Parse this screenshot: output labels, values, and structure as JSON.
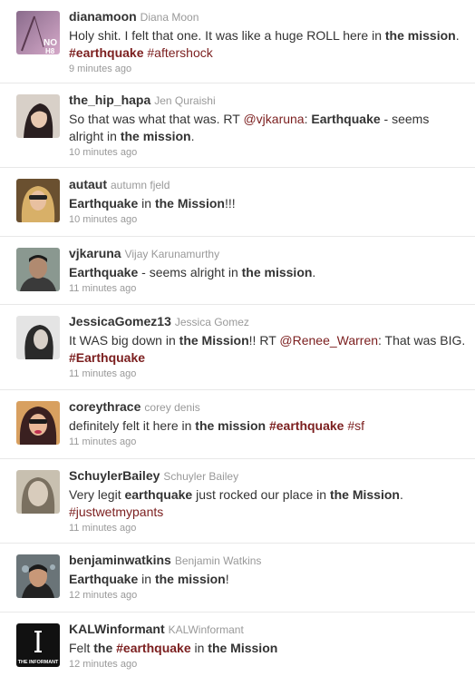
{
  "tweets": [
    {
      "username": "dianamoon",
      "fullname": "Diana Moon",
      "time": "9 minutes ago",
      "avatar_colors": [
        "#7a5c7a",
        "#c4a0c0"
      ],
      "parts": [
        {
          "t": "Holy shit. I felt that one. It was like a huge ROLL here in ",
          "s": "plain"
        },
        {
          "t": "the mission",
          "s": "bold"
        },
        {
          "t": ". ",
          "s": "plain"
        },
        {
          "t": "#earthquake",
          "s": "tag-bold"
        },
        {
          "t": " ",
          "s": "plain"
        },
        {
          "t": "#aftershock",
          "s": "tag"
        }
      ]
    },
    {
      "username": "the_hip_hapa",
      "fullname": "Jen Quraishi",
      "time": "10 minutes ago",
      "avatar_colors": [
        "#d9d0c8",
        "#2a2020"
      ],
      "parts": [
        {
          "t": "So that was what that was. RT ",
          "s": "plain"
        },
        {
          "t": "@vjkaruna",
          "s": "mention"
        },
        {
          "t": ": ",
          "s": "plain"
        },
        {
          "t": "Earthquake",
          "s": "bold"
        },
        {
          "t": " - seems alright in ",
          "s": "plain"
        },
        {
          "t": "the mission",
          "s": "bold"
        },
        {
          "t": ".",
          "s": "plain"
        }
      ]
    },
    {
      "username": "autaut",
      "fullname": "autumn fjeld",
      "time": "10 minutes ago",
      "avatar_colors": [
        "#8a6a3a",
        "#d8b070"
      ],
      "parts": [
        {
          "t": "Earthquake",
          "s": "bold"
        },
        {
          "t": " in ",
          "s": "plain"
        },
        {
          "t": "the Mission",
          "s": "bold"
        },
        {
          "t": "!!!",
          "s": "plain"
        }
      ]
    },
    {
      "username": "vjkaruna",
      "fullname": "Vijay Karunamurthy",
      "time": "11 minutes ago",
      "avatar_colors": [
        "#4a4a4a",
        "#b08a70"
      ],
      "parts": [
        {
          "t": "Earthquake",
          "s": "bold"
        },
        {
          "t": " - seems alright in ",
          "s": "plain"
        },
        {
          "t": "the mission",
          "s": "bold"
        },
        {
          "t": ".",
          "s": "plain"
        }
      ]
    },
    {
      "username": "JessicaGomez13",
      "fullname": "Jessica Gomez",
      "time": "11 minutes ago",
      "avatar_colors": [
        "#e0e0e0",
        "#3a3a3a"
      ],
      "parts": [
        {
          "t": "It WAS big down in ",
          "s": "plain"
        },
        {
          "t": "the Mission",
          "s": "bold"
        },
        {
          "t": "!! RT ",
          "s": "plain"
        },
        {
          "t": "@Renee_Warren",
          "s": "mention"
        },
        {
          "t": ": That was BIG. ",
          "s": "plain"
        },
        {
          "t": "#Earthquake",
          "s": "tag-bold"
        }
      ]
    },
    {
      "username": "coreythrace",
      "fullname": "corey denis",
      "time": "11 minutes ago",
      "avatar_colors": [
        "#c87848",
        "#4a2a28"
      ],
      "parts": [
        {
          "t": "definitely felt it here in ",
          "s": "plain"
        },
        {
          "t": "the mission",
          "s": "bold"
        },
        {
          "t": " ",
          "s": "plain"
        },
        {
          "t": "#earthquake",
          "s": "tag-bold"
        },
        {
          "t": " ",
          "s": "plain"
        },
        {
          "t": "#sf",
          "s": "tag"
        }
      ]
    },
    {
      "username": "SchuylerBailey",
      "fullname": "Schuyler Bailey",
      "time": "11 minutes ago",
      "avatar_colors": [
        "#b8b0a0",
        "#6a6458"
      ],
      "parts": [
        {
          "t": "Very legit ",
          "s": "plain"
        },
        {
          "t": "earthquake",
          "s": "bold"
        },
        {
          "t": " just rocked our place in ",
          "s": "plain"
        },
        {
          "t": "the Mission",
          "s": "bold"
        },
        {
          "t": ". ",
          "s": "plain"
        },
        {
          "t": "#justwetmypants",
          "s": "tag"
        }
      ]
    },
    {
      "username": "benjaminwatkins",
      "fullname": "Benjamin Watkins",
      "time": "12 minutes ago",
      "avatar_colors": [
        "#6a7070",
        "#2a2a2a"
      ],
      "parts": [
        {
          "t": "Earthquake",
          "s": "bold"
        },
        {
          "t": " in ",
          "s": "plain"
        },
        {
          "t": "the mission",
          "s": "bold"
        },
        {
          "t": "!",
          "s": "plain"
        }
      ]
    },
    {
      "username": "KALWinformant",
      "fullname": "KALWinformant",
      "time": "12 minutes ago",
      "avatar_colors": [
        "#111111",
        "#ffffff"
      ],
      "avatar_label": "THE INFORMANT",
      "parts": [
        {
          "t": "Felt ",
          "s": "plain"
        },
        {
          "t": "the",
          "s": "bold"
        },
        {
          "t": " ",
          "s": "plain"
        },
        {
          "t": "#earthquake",
          "s": "tag-bold"
        },
        {
          "t": " in ",
          "s": "plain"
        },
        {
          "t": "the Mission",
          "s": "bold"
        }
      ]
    }
  ]
}
